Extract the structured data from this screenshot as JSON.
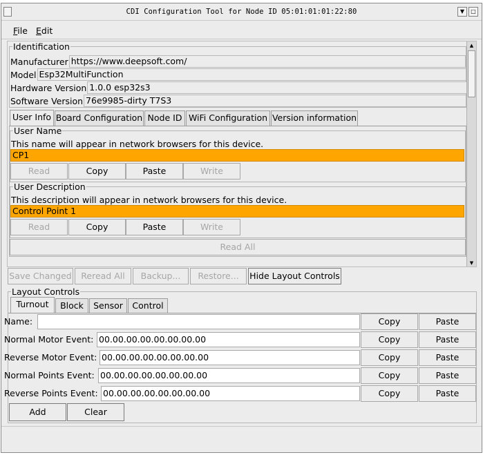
{
  "window": {
    "title": "CDI Configuration Tool for Node ID 05:01:01:01:22:80",
    "minimize_glyph": "▼",
    "maximize_glyph": "□"
  },
  "menu": {
    "file": "File",
    "edit": "Edit"
  },
  "identification": {
    "legend": "Identification",
    "rows": [
      {
        "label": "Manufacturer",
        "value": "https://www.deepsoft.com/"
      },
      {
        "label": "Model",
        "value": "Esp32MultiFunction"
      },
      {
        "label": "Hardware Version",
        "value": "1.0.0 esp32s3"
      },
      {
        "label": "Software Version",
        "value": "76e9985-dirty T7S3"
      }
    ]
  },
  "tabs": [
    {
      "label": "User Info",
      "active": true
    },
    {
      "label": "Board Configuration",
      "active": false
    },
    {
      "label": "Node ID",
      "active": false
    },
    {
      "label": "WiFi Configuration",
      "active": false
    },
    {
      "label": "Version information",
      "active": false
    }
  ],
  "user_name": {
    "legend": "User Name",
    "description": "This name will appear in network browsers for this device.",
    "value": "CP1"
  },
  "user_description": {
    "legend": "User Description",
    "description": "This description will appear in network browsers for this device.",
    "value": "Control Point 1"
  },
  "field_buttons": {
    "read": "Read",
    "copy": "Copy",
    "paste": "Paste",
    "write": "Write"
  },
  "read_all": "Read All",
  "bottom_buttons": {
    "save_changed": "Save Changed",
    "reread_all": "Reread All",
    "backup": "Backup...",
    "restore": "Restore...",
    "hide_layout": "Hide Layout Controls"
  },
  "layout_controls": {
    "legend": "Layout Controls",
    "tabs": [
      {
        "label": "Turnout",
        "active": true
      },
      {
        "label": "Block",
        "active": false
      },
      {
        "label": "Sensor",
        "active": false
      },
      {
        "label": "Control",
        "active": false
      }
    ],
    "rows": [
      {
        "label": "Name:",
        "value": ""
      },
      {
        "label": "Normal Motor Event:",
        "value": "00.00.00.00.00.00.00.00"
      },
      {
        "label": "Reverse Motor Event:",
        "value": "00.00.00.00.00.00.00.00"
      },
      {
        "label": "Normal Points Event:",
        "value": "00.00.00.00.00.00.00.00"
      },
      {
        "label": "Reverse Points Event:",
        "value": "00.00.00.00.00.00.00.00"
      }
    ],
    "copy": "Copy",
    "paste": "Paste",
    "add": "Add",
    "clear": "Clear"
  }
}
